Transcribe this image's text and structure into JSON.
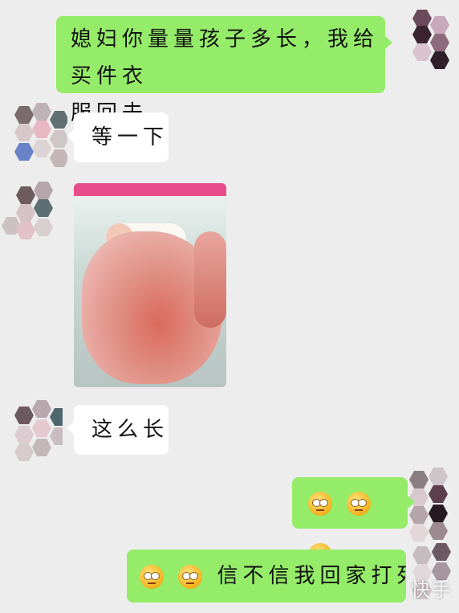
{
  "messages": [
    {
      "side": "right",
      "text_line1": "媳妇你量量孩子多长，我给买件衣",
      "text_line2": "服回去"
    },
    {
      "side": "left",
      "text": "等一下"
    },
    {
      "side": "left",
      "type": "image",
      "description": ""
    },
    {
      "side": "left",
      "text": "这么长"
    },
    {
      "side": "right",
      "type": "emoji",
      "emoji_count": 3,
      "emoji_name": "rolling-eyes-emoji"
    },
    {
      "side": "right",
      "text": "信不信我回家打死你"
    }
  ],
  "watermark": "快手",
  "colors": {
    "background": "#ededed",
    "own_bubble": "#95ec69",
    "other_bubble": "#ffffff"
  }
}
